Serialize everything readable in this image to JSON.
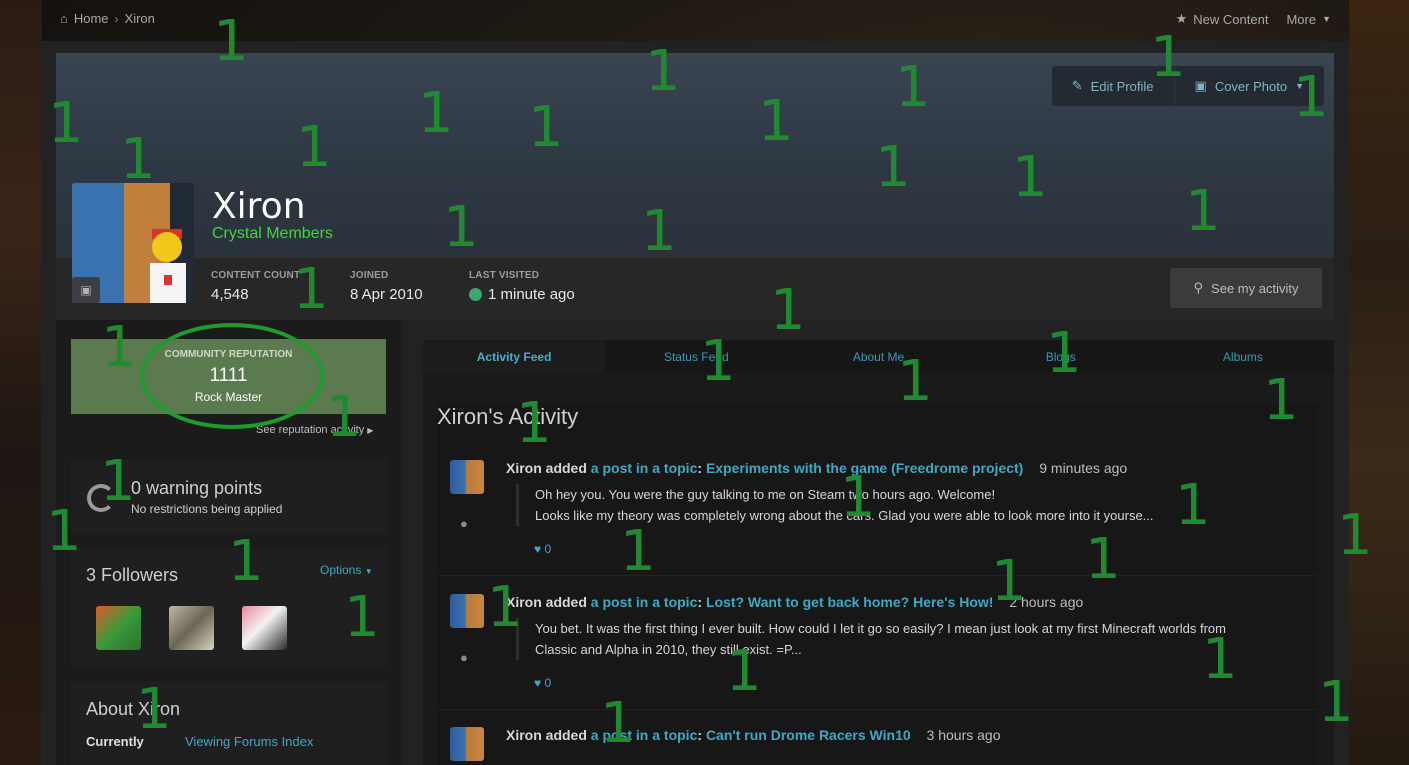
{
  "breadcrumb": {
    "home": "Home",
    "separator": "›",
    "current": "Xiron"
  },
  "topnav": {
    "new_content": "New Content",
    "more": "More"
  },
  "cover_actions": {
    "edit_profile": "Edit Profile",
    "cover_photo": "Cover Photo"
  },
  "profile": {
    "name": "Xiron",
    "group": "Crystal Members",
    "stats": [
      {
        "label": "CONTENT COUNT",
        "value": "4,548"
      },
      {
        "label": "JOINED",
        "value": "8 Apr 2010"
      },
      {
        "label": "LAST VISITED",
        "value": "1 minute ago"
      }
    ],
    "see_activity": "See my activity"
  },
  "reputation": {
    "label": "COMMUNITY REPUTATION",
    "value": "1111",
    "rank": "Rock Master",
    "link": "See reputation activity"
  },
  "warnings": {
    "title": "0 warning points",
    "subtitle": "No restrictions being applied"
  },
  "followers": {
    "title": "3 Followers",
    "options": "Options"
  },
  "about": {
    "title": "About Xiron",
    "currently_label": "Currently",
    "currently_value": "Viewing Forums Index"
  },
  "tabs": [
    "Activity Feed",
    "Status Feed",
    "About Me",
    "Blogs",
    "Albums"
  ],
  "feed": {
    "title": "Xiron's Activity",
    "entries": [
      {
        "who": "Xiron",
        "added": "added",
        "post": "a post in a topic",
        "colon": ":",
        "topic": "Experiments with the game (Freedrome project)",
        "time": "9 minutes ago",
        "line1": "Oh hey you. You were the guy talking to me on Steam two hours ago. Welcome!",
        "line2": "Looks like my theory was completely wrong about the cars. Glad you were able to look more into it yourse...",
        "likes": "0"
      },
      {
        "who": "Xiron",
        "added": "added",
        "post": "a post in a topic",
        "colon": ":",
        "topic": "Lost? Want to get back home? Here's How!",
        "time": "2 hours ago",
        "line1": "You bet. It was the first thing I ever built. How could I let it go so easily? I mean just look at my first Minecraft worlds from",
        "line2": "Classic and Alpha in 2010, they still exist. =P...",
        "likes": "0"
      },
      {
        "who": "Xiron",
        "added": "added",
        "post": "a post in a topic",
        "colon": ":",
        "topic": "Can't run Drome Racers Win10",
        "time": "3 hours ago"
      }
    ]
  },
  "overlay_marks": [
    "1",
    "1",
    "1",
    "1",
    "1",
    "1",
    "1",
    "1",
    "1",
    "1",
    "1",
    "1",
    "1",
    "1",
    "1",
    "1",
    "1",
    "1",
    "1",
    "1",
    "1",
    "1",
    "1",
    "1",
    "1",
    "1",
    "1",
    "1",
    "1",
    "1",
    "1",
    "1",
    "1",
    "1",
    "1",
    "1",
    "1",
    "1",
    "1",
    "1"
  ]
}
